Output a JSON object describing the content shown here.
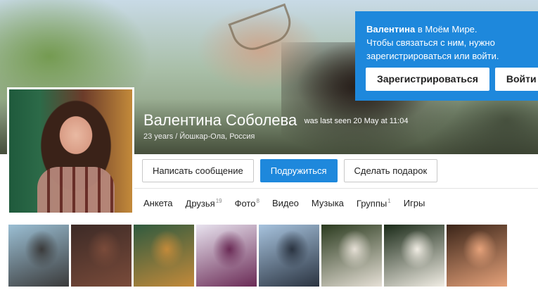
{
  "cover": {
    "alt": "cover-photo"
  },
  "signup_box": {
    "name_bold": "Валентина",
    "line1_rest": " в Моём Мире.",
    "line2": "Чтобы связаться с ним, нужно",
    "line3": "зарегистрироваться или войти.",
    "register_label": "Зарегистрироваться",
    "login_label": "Войти"
  },
  "profile": {
    "name": "Валентина Соболева",
    "last_seen": "was last seen 20 May at 11:04",
    "subtitle": "23 years / Йошкар-Ола, Россия"
  },
  "actions": {
    "message_label": "Написать сообщение",
    "friend_label": "Подружиться",
    "gift_label": "Сделать подарок"
  },
  "tabs": [
    {
      "label": "Анкета",
      "count": ""
    },
    {
      "label": "Друзья",
      "count": "19"
    },
    {
      "label": "Фото",
      "count": "8"
    },
    {
      "label": "Видео",
      "count": ""
    },
    {
      "label": "Музыка",
      "count": ""
    },
    {
      "label": "Группы",
      "count": "1"
    },
    {
      "label": "Игры",
      "count": ""
    }
  ],
  "colors": {
    "accent": "#1e88dc",
    "text": "#222222"
  },
  "photos": [
    {
      "name": "photo-1",
      "c1": "#9bbfd4",
      "c2": "#3a3a3a"
    },
    {
      "name": "photo-2",
      "c1": "#3c2a26",
      "c2": "#7a4b3a"
    },
    {
      "name": "photo-3",
      "c1": "#2f5a3f",
      "c2": "#c38a3a"
    },
    {
      "name": "photo-4",
      "c1": "#e8e3ef",
      "c2": "#6a2a55"
    },
    {
      "name": "photo-5",
      "c1": "#a7c3de",
      "c2": "#2a3340"
    },
    {
      "name": "photo-6",
      "c1": "#2a3a1e",
      "c2": "#e6e0d6"
    },
    {
      "name": "photo-7",
      "c1": "#1a2a18",
      "c2": "#f1ede4"
    },
    {
      "name": "photo-8",
      "c1": "#3a2418",
      "c2": "#e6a27a"
    }
  ]
}
